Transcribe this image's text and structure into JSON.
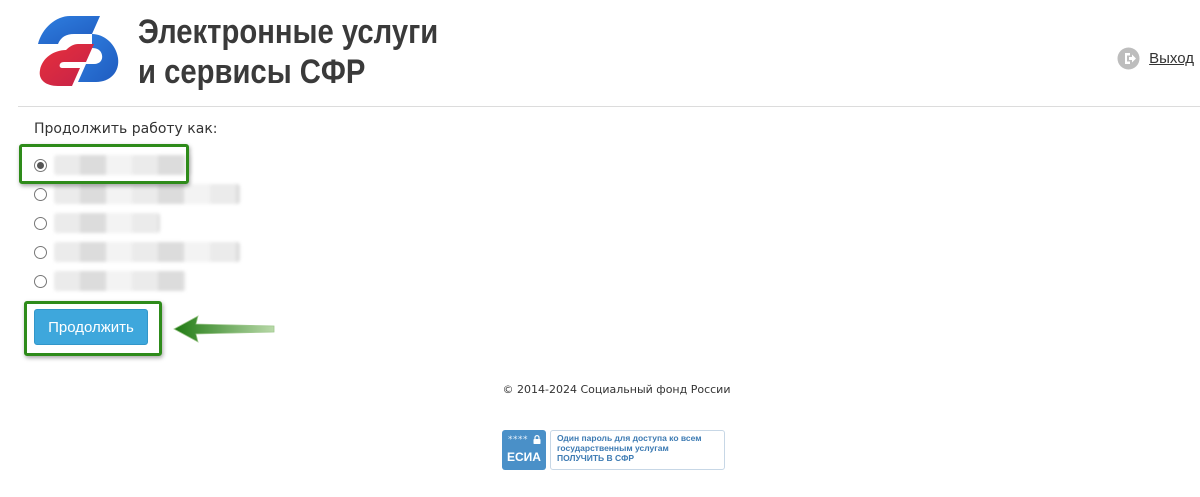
{
  "header": {
    "title_line1": "Электронные услуги",
    "title_line2": "и сервисы СФР",
    "logout_label": "Выход",
    "colors": {
      "logo_red": "#e7303b",
      "logo_blue": "#2a6fd0"
    }
  },
  "accounts": {
    "prompt": "Продолжить работу как:",
    "selected_index": 0,
    "option_count": 5
  },
  "actions": {
    "continue_label": "Продолжить"
  },
  "footer": {
    "copyright": "© 2014-2024 Социальный фонд России",
    "esia": {
      "logo_stars": "****",
      "logo_name": "ЕСИА",
      "line1": "Один пароль для доступа ко всем",
      "line2": "государственным услугам",
      "line3": "ПОЛУЧИТЬ В СФР"
    }
  },
  "annotation": {
    "color": "#2e8b1a"
  }
}
